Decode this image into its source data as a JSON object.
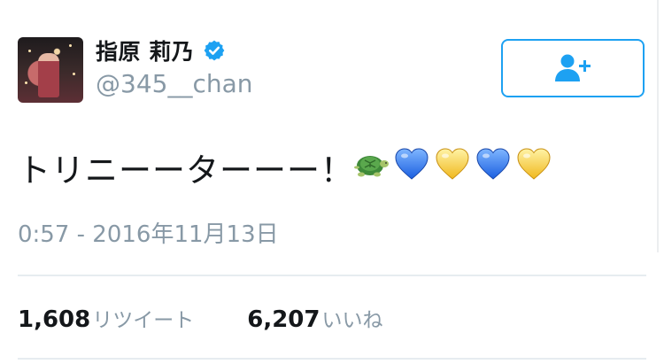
{
  "tweet": {
    "author": {
      "display_name": "指原 莉乃",
      "handle": "@345__chan",
      "verified": true
    },
    "text": "トリニーーターーー！",
    "emoji": [
      "turtle-emoji",
      "blue-heart-emoji",
      "yellow-heart-emoji",
      "blue-heart-emoji",
      "yellow-heart-emoji"
    ],
    "timestamp": "0:57 - 2016年11月13日",
    "stats": {
      "retweets_count": "1,608",
      "retweets_label": "リツイート",
      "likes_count": "6,207",
      "likes_label": "いいね"
    }
  },
  "colors": {
    "accent": "#1da1f2",
    "text_primary": "#14171a",
    "text_secondary": "#8899a6",
    "divider": "#e6ecf0"
  }
}
